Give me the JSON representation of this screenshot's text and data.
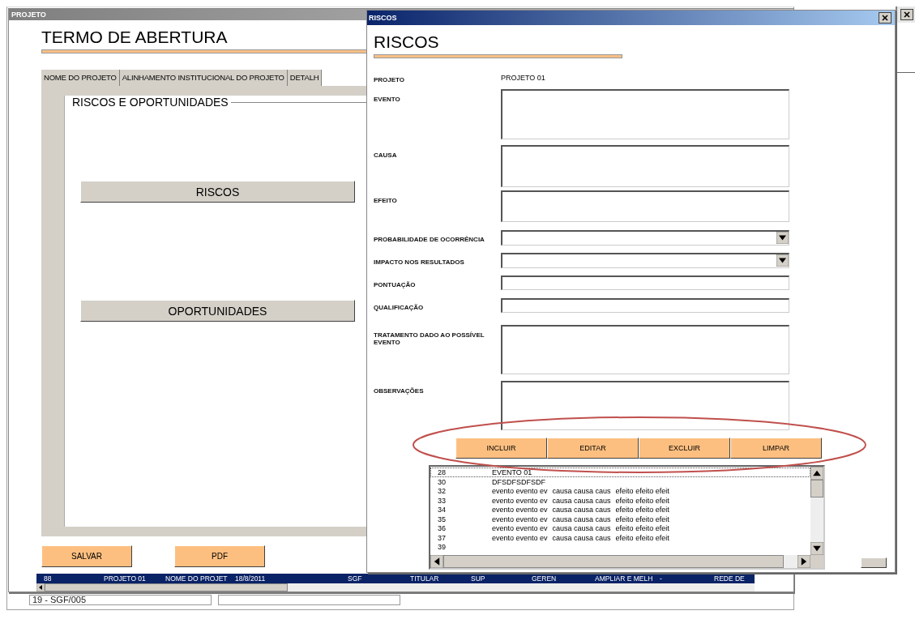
{
  "background_window": {
    "combo_value": "19 - SGF/005"
  },
  "projeto_window": {
    "title": "PROJETO",
    "heading": "TERMO DE ABERTURA",
    "tabs": [
      {
        "label": "NOME DO PROJETO"
      },
      {
        "label": "ALINHAMENTO INSTITUCIONAL DO PROJETO"
      },
      {
        "label": "DETALH"
      }
    ],
    "group_title": "RISCOS E OPORTUNIDADES",
    "group_buttons": [
      "RISCOS",
      "OPORTUNIDADES"
    ],
    "buttons": [
      "SALVAR",
      "PDF"
    ],
    "status_bar": [
      "88",
      "PROJETO 01",
      "NOME DO PROJET",
      "18/8/2011",
      "SGF",
      "TITULAR",
      "SUP",
      "GEREN",
      "AMPLIAR E MELH",
      "-",
      "REDE DE"
    ]
  },
  "riscos_window": {
    "title": "RISCOS",
    "heading": "RISCOS",
    "fields": [
      {
        "label": "PROJETO",
        "kind": "text",
        "value": "PROJETO 01"
      },
      {
        "label": "EVENTO",
        "kind": "textarea"
      },
      {
        "label": "CAUSA",
        "kind": "textarea"
      },
      {
        "label": "EFEITO",
        "kind": "textarea"
      },
      {
        "label": "PROBABILIDADE DE OCORRÊNCIA",
        "kind": "combo"
      },
      {
        "label": "IMPACTO NOS RESULTADOS",
        "kind": "combo"
      },
      {
        "label": "PONTUAÇÃO",
        "kind": "input"
      },
      {
        "label": "QUALIFICAÇÃO",
        "kind": "input"
      },
      {
        "label": "TRATAMENTO DADO AO POSSÍVEL EVENTO",
        "kind": "textarea"
      },
      {
        "label": "OBSERVAÇÕES",
        "kind": "textarea"
      }
    ],
    "buttons": [
      "INCLUIR",
      "EDITAR",
      "EXCLUIR",
      "LIMPAR"
    ],
    "list": {
      "rows": [
        {
          "id": "28",
          "cells": [
            "EVENTO 01"
          ],
          "focused": true
        },
        {
          "id": "30",
          "cells": [
            "DFSDFSDFSDF"
          ],
          "focused": false
        },
        {
          "id": "32",
          "cells": [
            "evento  evento ev",
            "causa causa caus",
            "efeito efeito efeit"
          ],
          "focused": false
        },
        {
          "id": "33",
          "cells": [
            "evento  evento ev",
            "causa causa caus",
            "efeito efeito efeit"
          ],
          "focused": false
        },
        {
          "id": "34",
          "cells": [
            "evento  evento ev",
            "causa causa caus",
            "efeito efeito efeit"
          ],
          "focused": false
        },
        {
          "id": "35",
          "cells": [
            "evento  evento ev",
            "causa causa caus",
            "efeito efeito efeit"
          ],
          "focused": false
        },
        {
          "id": "36",
          "cells": [
            "evento  evento ev",
            "causa causa caus",
            "efeito efeito efeit"
          ],
          "focused": false
        },
        {
          "id": "37",
          "cells": [
            "evento  evento ev",
            "causa causa caus",
            "efeito efeito efeit"
          ],
          "focused": false
        },
        {
          "id": "39",
          "cells": [],
          "focused": false
        }
      ]
    }
  }
}
